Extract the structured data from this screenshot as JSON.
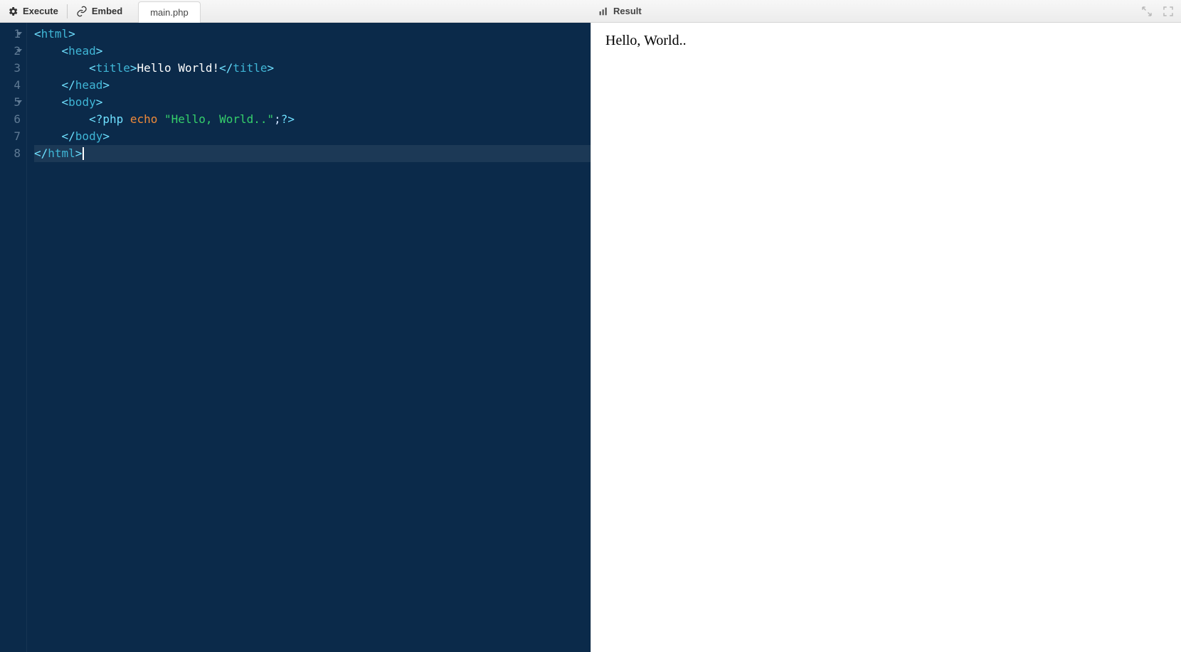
{
  "toolbar": {
    "execute_label": "Execute",
    "embed_label": "Embed"
  },
  "tab": {
    "filename": "main.php"
  },
  "result": {
    "label": "Result",
    "output": "Hello, World.."
  },
  "icons": {
    "execute": "gears-icon",
    "embed": "link-icon",
    "result": "bar-chart-icon",
    "expand": "expand-icon",
    "fullscreen": "fullscreen-icon"
  },
  "editor": {
    "active_line": 8,
    "lines": [
      {
        "n": 1,
        "fold": true,
        "indent": 0,
        "tokens": [
          [
            "angle",
            "<"
          ],
          [
            "tag",
            "html"
          ],
          [
            "angle",
            ">"
          ]
        ]
      },
      {
        "n": 2,
        "fold": true,
        "indent": 1,
        "tokens": [
          [
            "angle",
            "<"
          ],
          [
            "tag",
            "head"
          ],
          [
            "angle",
            ">"
          ]
        ]
      },
      {
        "n": 3,
        "fold": false,
        "indent": 2,
        "tokens": [
          [
            "angle",
            "<"
          ],
          [
            "tag",
            "title"
          ],
          [
            "angle",
            ">"
          ],
          [
            "text",
            "Hello World!"
          ],
          [
            "angle",
            "</"
          ],
          [
            "tag",
            "title"
          ],
          [
            "angle",
            ">"
          ]
        ]
      },
      {
        "n": 4,
        "fold": false,
        "indent": 1,
        "tokens": [
          [
            "angle",
            "</"
          ],
          [
            "tag",
            "head"
          ],
          [
            "angle",
            ">"
          ]
        ]
      },
      {
        "n": 5,
        "fold": true,
        "indent": 1,
        "tokens": [
          [
            "angle",
            "<"
          ],
          [
            "tag",
            "body"
          ],
          [
            "angle",
            ">"
          ]
        ]
      },
      {
        "n": 6,
        "fold": false,
        "indent": 2,
        "tokens": [
          [
            "php",
            "<?php "
          ],
          [
            "kw",
            "echo"
          ],
          [
            "text",
            " "
          ],
          [
            "str",
            "\"Hello, World..\""
          ],
          [
            "punct",
            ";"
          ],
          [
            "php",
            "?>"
          ]
        ]
      },
      {
        "n": 7,
        "fold": false,
        "indent": 1,
        "tokens": [
          [
            "angle",
            "</"
          ],
          [
            "tag",
            "body"
          ],
          [
            "angle",
            ">"
          ]
        ]
      },
      {
        "n": 8,
        "fold": false,
        "indent": 0,
        "tokens": [
          [
            "angle",
            "</"
          ],
          [
            "tag",
            "html"
          ],
          [
            "angle",
            ">"
          ]
        ]
      }
    ]
  }
}
